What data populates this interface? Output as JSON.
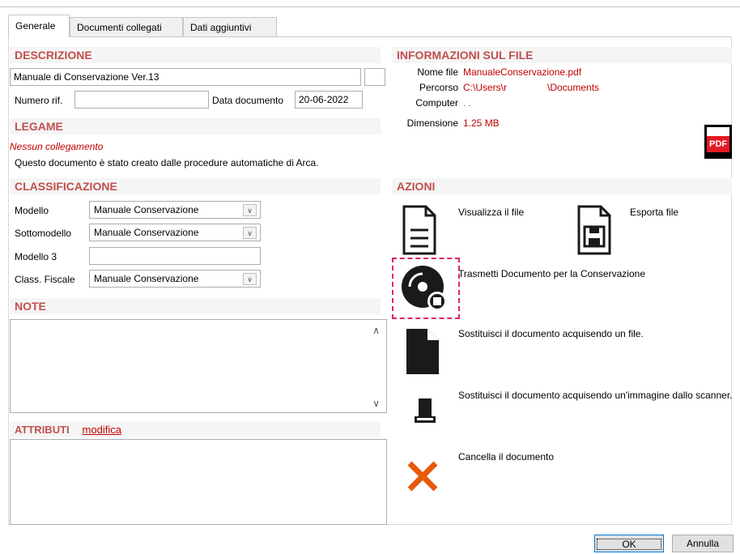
{
  "tabs": [
    "Generale",
    "Documenti collegati",
    "Dati aggiuntivi"
  ],
  "descrizione": {
    "header": "DESCRIZIONE",
    "title_value": "Manuale di Conservazione Ver.13",
    "numero_rif_label": "Numero rif.",
    "numero_rif_value": "",
    "data_documento_label": "Data documento",
    "data_documento_value": "20-06-2022"
  },
  "legame": {
    "header": "LEGAME",
    "link_status": "Nessun collegamento",
    "note": "Questo documento è stato creato dalle procedure automatiche di Arca."
  },
  "classificazione": {
    "header": "CLASSIFICAZIONE",
    "modello_label": "Modello",
    "modello_value": "Manuale Conservazione",
    "sottomodello_label": "Sottomodello",
    "sottomodello_value": "Manuale Conservazione",
    "modello3_label": "Modello 3",
    "modello3_value": "",
    "class_fiscale_label": "Class. Fiscale",
    "class_fiscale_value": "Manuale Conservazione"
  },
  "note": {
    "header": "NOTE",
    "value": ""
  },
  "attributi": {
    "header": "ATTRIBUTI",
    "link": "modifica"
  },
  "info_file": {
    "header": "INFORMAZIONI SUL FILE",
    "nome_file_label": "Nome file",
    "nome_file_value": "ManualeConservazione.pdf",
    "percorso_label": "Percorso",
    "percorso_value": "C:\\Users\\r               \\Documents",
    "computer_label": "Computer",
    "computer_value": ". .",
    "dimensione_label": "Dimensione",
    "dimensione_value": "1.25 MB",
    "pdf_badge": "PDF"
  },
  "azioni": {
    "header": "AZIONI",
    "visualizza": "Visualizza il file",
    "esporta": "Esporta file",
    "trasmetti": "Trasmetti Documento per la Conservazione",
    "sostituisci_file": "Sostituisci il documento acquisendo un file.",
    "sostituisci_scanner": "Sostituisci il documento acquisendo un'immagine dallo scanner.",
    "cancella": "Cancella il documento"
  },
  "footer": {
    "ok": "OK",
    "annulla": "Annulla"
  },
  "colors": {
    "section_header": "#c0504d",
    "value_red": "#c00000",
    "highlight_dash": "#e0245e",
    "delete_orange": "#e8590c"
  }
}
